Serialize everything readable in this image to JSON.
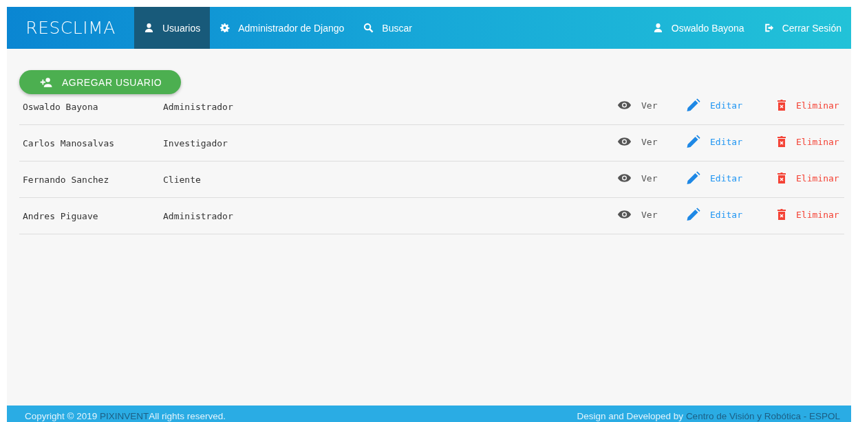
{
  "navbar": {
    "brand": "RESCLIMA",
    "items": [
      {
        "label": "Usuarios",
        "kind": "user",
        "selected": true
      },
      {
        "label": "Administrador de Django",
        "kind": "gear",
        "selected": false
      },
      {
        "label": "Buscar",
        "kind": "search",
        "selected": false
      }
    ],
    "right_items": [
      {
        "label": "Oswaldo Bayona",
        "kind": "user"
      },
      {
        "label": "Cerrar Sesión",
        "kind": "logout"
      }
    ]
  },
  "add_button": {
    "label": "AGREGAR USUARIO"
  },
  "users": [
    {
      "name": "Oswaldo Bayona",
      "role": "Administrador",
      "actions": [
        {
          "kind": "view",
          "label": "Ver"
        },
        {
          "kind": "edit",
          "label": "Editar"
        },
        {
          "kind": "delete",
          "label": "Eliminar"
        }
      ]
    },
    {
      "name": "Carlos Manosalvas",
      "role": "Investigador",
      "actions": [
        {
          "kind": "view",
          "label": "Ver"
        },
        {
          "kind": "edit",
          "label": "Editar"
        },
        {
          "kind": "delete",
          "label": "Eliminar"
        }
      ]
    },
    {
      "name": "Fernando Sanchez",
      "role": "Cliente",
      "actions": [
        {
          "kind": "view",
          "label": "Ver"
        },
        {
          "kind": "edit",
          "label": "Editar"
        },
        {
          "kind": "delete",
          "label": "Eliminar"
        }
      ]
    },
    {
      "name": "Andres Piguave",
      "role": "Administrador",
      "actions": [
        {
          "kind": "view",
          "label": "Ver"
        },
        {
          "kind": "edit",
          "label": "Editar"
        },
        {
          "kind": "delete",
          "label": "Eliminar"
        }
      ]
    }
  ],
  "footer": {
    "left": {
      "text": "Copyright © 2019",
      "link": "PIXINVENT",
      "after": "All rights reserved."
    },
    "right": {
      "text": "Design and Developed by",
      "link": "Centro de Visión y Robótica - ESPOL"
    }
  }
}
